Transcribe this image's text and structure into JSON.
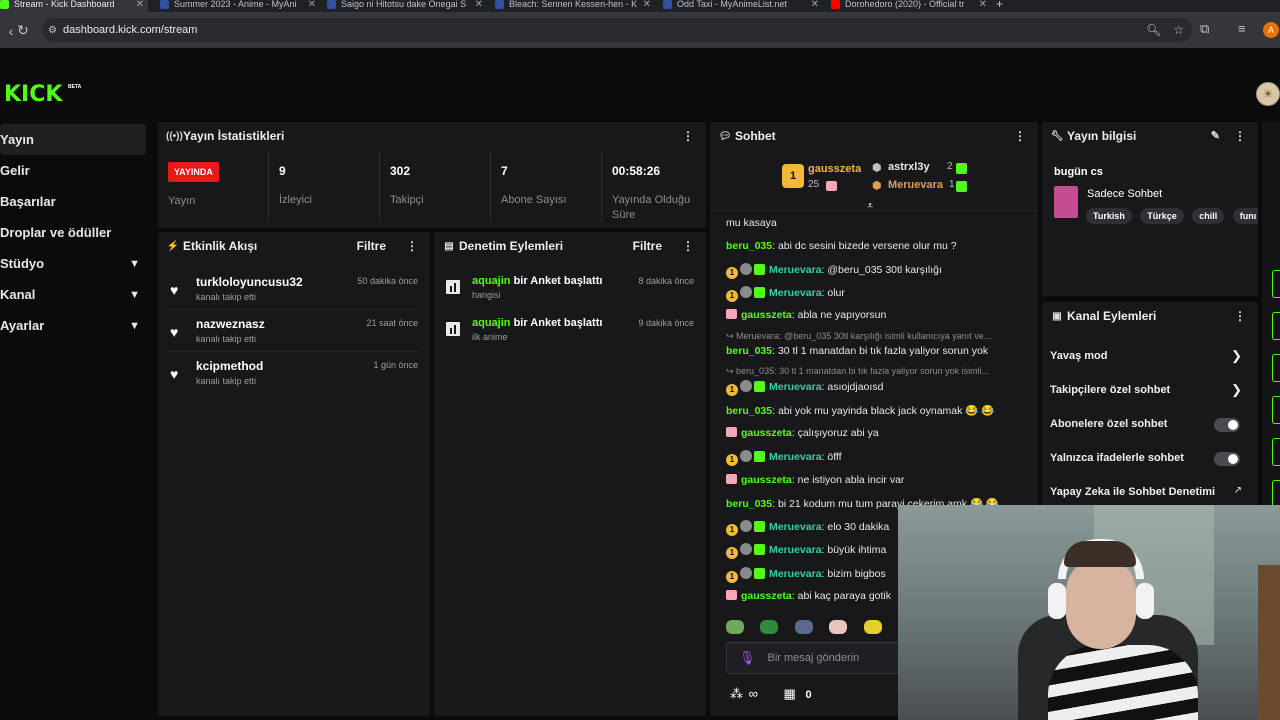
{
  "browser": {
    "tabs": [
      {
        "title": "Stream - Kick Dashboard",
        "active": true,
        "color": "#53fc18"
      },
      {
        "title": "Summer 2023 - Anime - MyAni",
        "active": false,
        "color": "#2e51a2"
      },
      {
        "title": "Saigo ni Hitotsu dake Onegai S",
        "active": false,
        "color": "#2e51a2"
      },
      {
        "title": "Bleach: Sennen Kessen-hen - K",
        "active": false,
        "color": "#2e51a2"
      },
      {
        "title": "Odd Taxi - MyAnimeList.net",
        "active": false,
        "color": "#2e51a2"
      },
      {
        "title": "Dorohedoro (2020) - Official tr",
        "active": false,
        "color": "#ff0000"
      }
    ],
    "url": "dashboard.kick.com/stream",
    "profile_initial": "A"
  },
  "brand": {
    "logo": "KICK",
    "beta": "BETA",
    "accent": "#53fc18"
  },
  "sidebar": {
    "items": [
      {
        "label": "Yayın",
        "active": true,
        "expandable": false
      },
      {
        "label": "Gelir",
        "active": false,
        "expandable": false
      },
      {
        "label": "Başarılar",
        "active": false,
        "expandable": false
      },
      {
        "label": "Droplar ve ödüller",
        "active": false,
        "expandable": false
      },
      {
        "label": "Stüdyo",
        "active": false,
        "expandable": true
      },
      {
        "label": "Kanal",
        "active": false,
        "expandable": true
      },
      {
        "label": "Ayarlar",
        "active": false,
        "expandable": true
      }
    ]
  },
  "stats": {
    "title": "Yayın İstatistikleri",
    "live_badge": "YAYINDA",
    "status_label": "Yayın",
    "items": [
      {
        "value": "9",
        "label": "İzleyici"
      },
      {
        "value": "302",
        "label": "Takipçi"
      },
      {
        "value": "7",
        "label": "Abone Sayısı"
      },
      {
        "value": "00:58:26",
        "label": "Yayında Olduğu Süre"
      }
    ]
  },
  "activity": {
    "title": "Etkinlik Akışı",
    "filter": "Filtre",
    "items": [
      {
        "name": "turkloloyuncusu32",
        "sub": "kanalı takip etti",
        "time": "50 dakika önce"
      },
      {
        "name": "nazweznasz",
        "sub": "kanalı takip etti",
        "time": "21 saat önce"
      },
      {
        "name": "kcipmethod",
        "sub": "kanalı takip etti",
        "time": "1 gün önce"
      }
    ]
  },
  "moderation": {
    "title": "Denetim Eylemleri",
    "filter": "Filtre",
    "items": [
      {
        "user": "aquajin",
        "action": "bir Anket başlattı",
        "sub": "hangisi",
        "time": "8 dakika önce"
      },
      {
        "user": "aquajin",
        "action": "bir Anket başlattı",
        "sub": "ilk anime",
        "time": "9 dakika önce"
      }
    ]
  },
  "chat": {
    "title": "Sohbet",
    "leaderboard": {
      "first": {
        "rank": "1",
        "name": "gausszeta",
        "count": "25"
      },
      "second": {
        "name": "astrxl3y",
        "count": "2"
      },
      "third": {
        "name": "Meruevara",
        "count": "1"
      }
    },
    "messages": [
      {
        "user": "",
        "text": "mu kasaya",
        "badges": "",
        "color": "#e8e8e8"
      },
      {
        "user": "beru_035",
        "text": ": abi dc sesini bizede versene olur mu ?",
        "badges": "",
        "color": "#53fc18"
      },
      {
        "user": "Meruevara",
        "text": ": @beru_035 30tl karşılığı",
        "badges": "full",
        "color": "#2fd3a5"
      },
      {
        "user": "Meruevara",
        "text": ": olur",
        "badges": "full",
        "color": "#2fd3a5"
      },
      {
        "user": "gausszeta",
        "text": ": abla ne yapıyorsun",
        "badges": "gift",
        "color": "#53fc18"
      },
      {
        "user": "beru_035",
        "text": ": 30 tl 1 manatdan bi tık fazla yaliyor sorun yok",
        "badges": "",
        "color": "#53fc18"
      },
      {
        "user": "Meruevara",
        "text": ": asıojdjaoısd",
        "badges": "full",
        "color": "#2fd3a5"
      },
      {
        "user": "beru_035",
        "text": ": abi yok mu yayinda black jack oynamak 😂 😂",
        "badges": "",
        "color": "#53fc18"
      },
      {
        "user": "gausszeta",
        "text": ": çalışıyoruz abi ya",
        "badges": "gift",
        "color": "#53fc18"
      },
      {
        "user": "Meruevara",
        "text": ": öfff",
        "badges": "full",
        "color": "#2fd3a5"
      },
      {
        "user": "gausszeta",
        "text": ": ne istiyon abla incir var",
        "badges": "gift",
        "color": "#53fc18"
      },
      {
        "user": "beru_035",
        "text": ": bi 21 kodum mu tum parayi cekerim amk 😂 😂",
        "badges": "",
        "color": "#53fc18"
      },
      {
        "user": "Meruevara",
        "text": ": elo 30 dakika",
        "badges": "full",
        "color": "#2fd3a5"
      },
      {
        "user": "Meruevara",
        "text": ": büyük ihtima",
        "badges": "full",
        "color": "#2fd3a5"
      },
      {
        "user": "Meruevara",
        "text": ": bizim bigbos",
        "badges": "full",
        "color": "#2fd3a5"
      },
      {
        "user": "gausszeta",
        "text": ": abi kaç paraya gotik",
        "badges": "gift",
        "color": "#53fc18"
      }
    ],
    "replies": [
      "↪ Meruevara: @beru_035 30tl karşılığı isimli kullanıcıya yanıt ve...",
      "↪ beru_035: 30 tl 1 manatdan bi tık fazla yaliyor sorun yok isimli..."
    ],
    "input_placeholder": "Bir mesaj gönderin",
    "infinity": "∞",
    "count": "0"
  },
  "stream_info": {
    "title": "Yayın bilgisi",
    "stream_title": "bugün cs",
    "category": "Sadece Sohbet",
    "tags": [
      "Turkish",
      "Türkçe",
      "chill",
      "funı"
    ]
  },
  "channel_actions": {
    "title": "Kanal Eylemleri",
    "items": [
      {
        "label": "Yavaş mod",
        "control": "arrow"
      },
      {
        "label": "Takipçilere özel sohbet",
        "control": "arrow"
      },
      {
        "label": "Abonelere özel sohbet",
        "control": "toggle"
      },
      {
        "label": "Yalnızca ifadelerle sohbet",
        "control": "toggle"
      },
      {
        "label": "Yapay Zeka ile Sohbet Denetimi",
        "control": "external"
      }
    ]
  }
}
